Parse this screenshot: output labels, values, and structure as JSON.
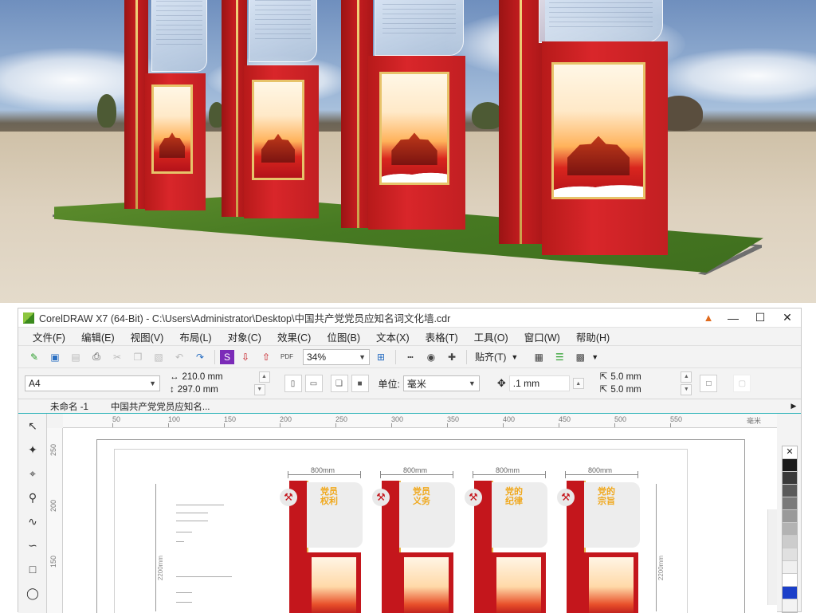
{
  "app": {
    "title": "CorelDRAW X7 (64-Bit) - C:\\Users\\Administrator\\Desktop\\中国共产党党员应知名词文化墙.cdr",
    "window_controls": [
      "—",
      "☐",
      "✕"
    ]
  },
  "menu": [
    "文件(F)",
    "编辑(E)",
    "视图(V)",
    "布局(L)",
    "对象(C)",
    "效果(C)",
    "位图(B)",
    "文本(X)",
    "表格(T)",
    "工具(O)",
    "窗口(W)",
    "帮助(H)"
  ],
  "toolbar": {
    "zoom": "34%",
    "snap_label": "贴齐(T)"
  },
  "propbar": {
    "page_size": "A4",
    "width": "210.0 mm",
    "height": "297.0 mm",
    "units_label": "单位:",
    "units_value": "毫米",
    "nudge": ".1 mm",
    "dup_x": "5.0 mm",
    "dup_y": "5.0 mm"
  },
  "tabs": [
    "未命名 -1",
    "中国共产党党员应知名..."
  ],
  "ruler": {
    "h_ticks": [
      "50",
      "100",
      "150",
      "200",
      "250",
      "300",
      "350",
      "400",
      "450",
      "500",
      "550"
    ],
    "units": "毫米",
    "v_ticks": [
      "250",
      "200",
      "150"
    ]
  },
  "design": {
    "boards": [
      {
        "width_label": "800mm",
        "heading": [
          "党员",
          "权利"
        ]
      },
      {
        "width_label": "800mm",
        "heading": [
          "党员",
          "义务"
        ]
      },
      {
        "width_label": "800mm",
        "heading": [
          "党的",
          "纪律"
        ]
      },
      {
        "width_label": "800mm",
        "heading": [
          "党的",
          "宗旨"
        ]
      }
    ],
    "height_label": "2200mm"
  },
  "palette": [
    "#ffffff",
    "#1a1a1a",
    "#3a3a3a",
    "#5a5a5a",
    "#7a7a7a",
    "#9a9a9a",
    "#b3b3b3",
    "#cccccc",
    "#e0e0e0",
    "#f0f0f0",
    "#ffffff",
    "#1b3fc9"
  ],
  "colors": {
    "accent_teal": "#24b0b6",
    "board_red": "#c4161c",
    "heading_gold": "#f0a81c"
  }
}
